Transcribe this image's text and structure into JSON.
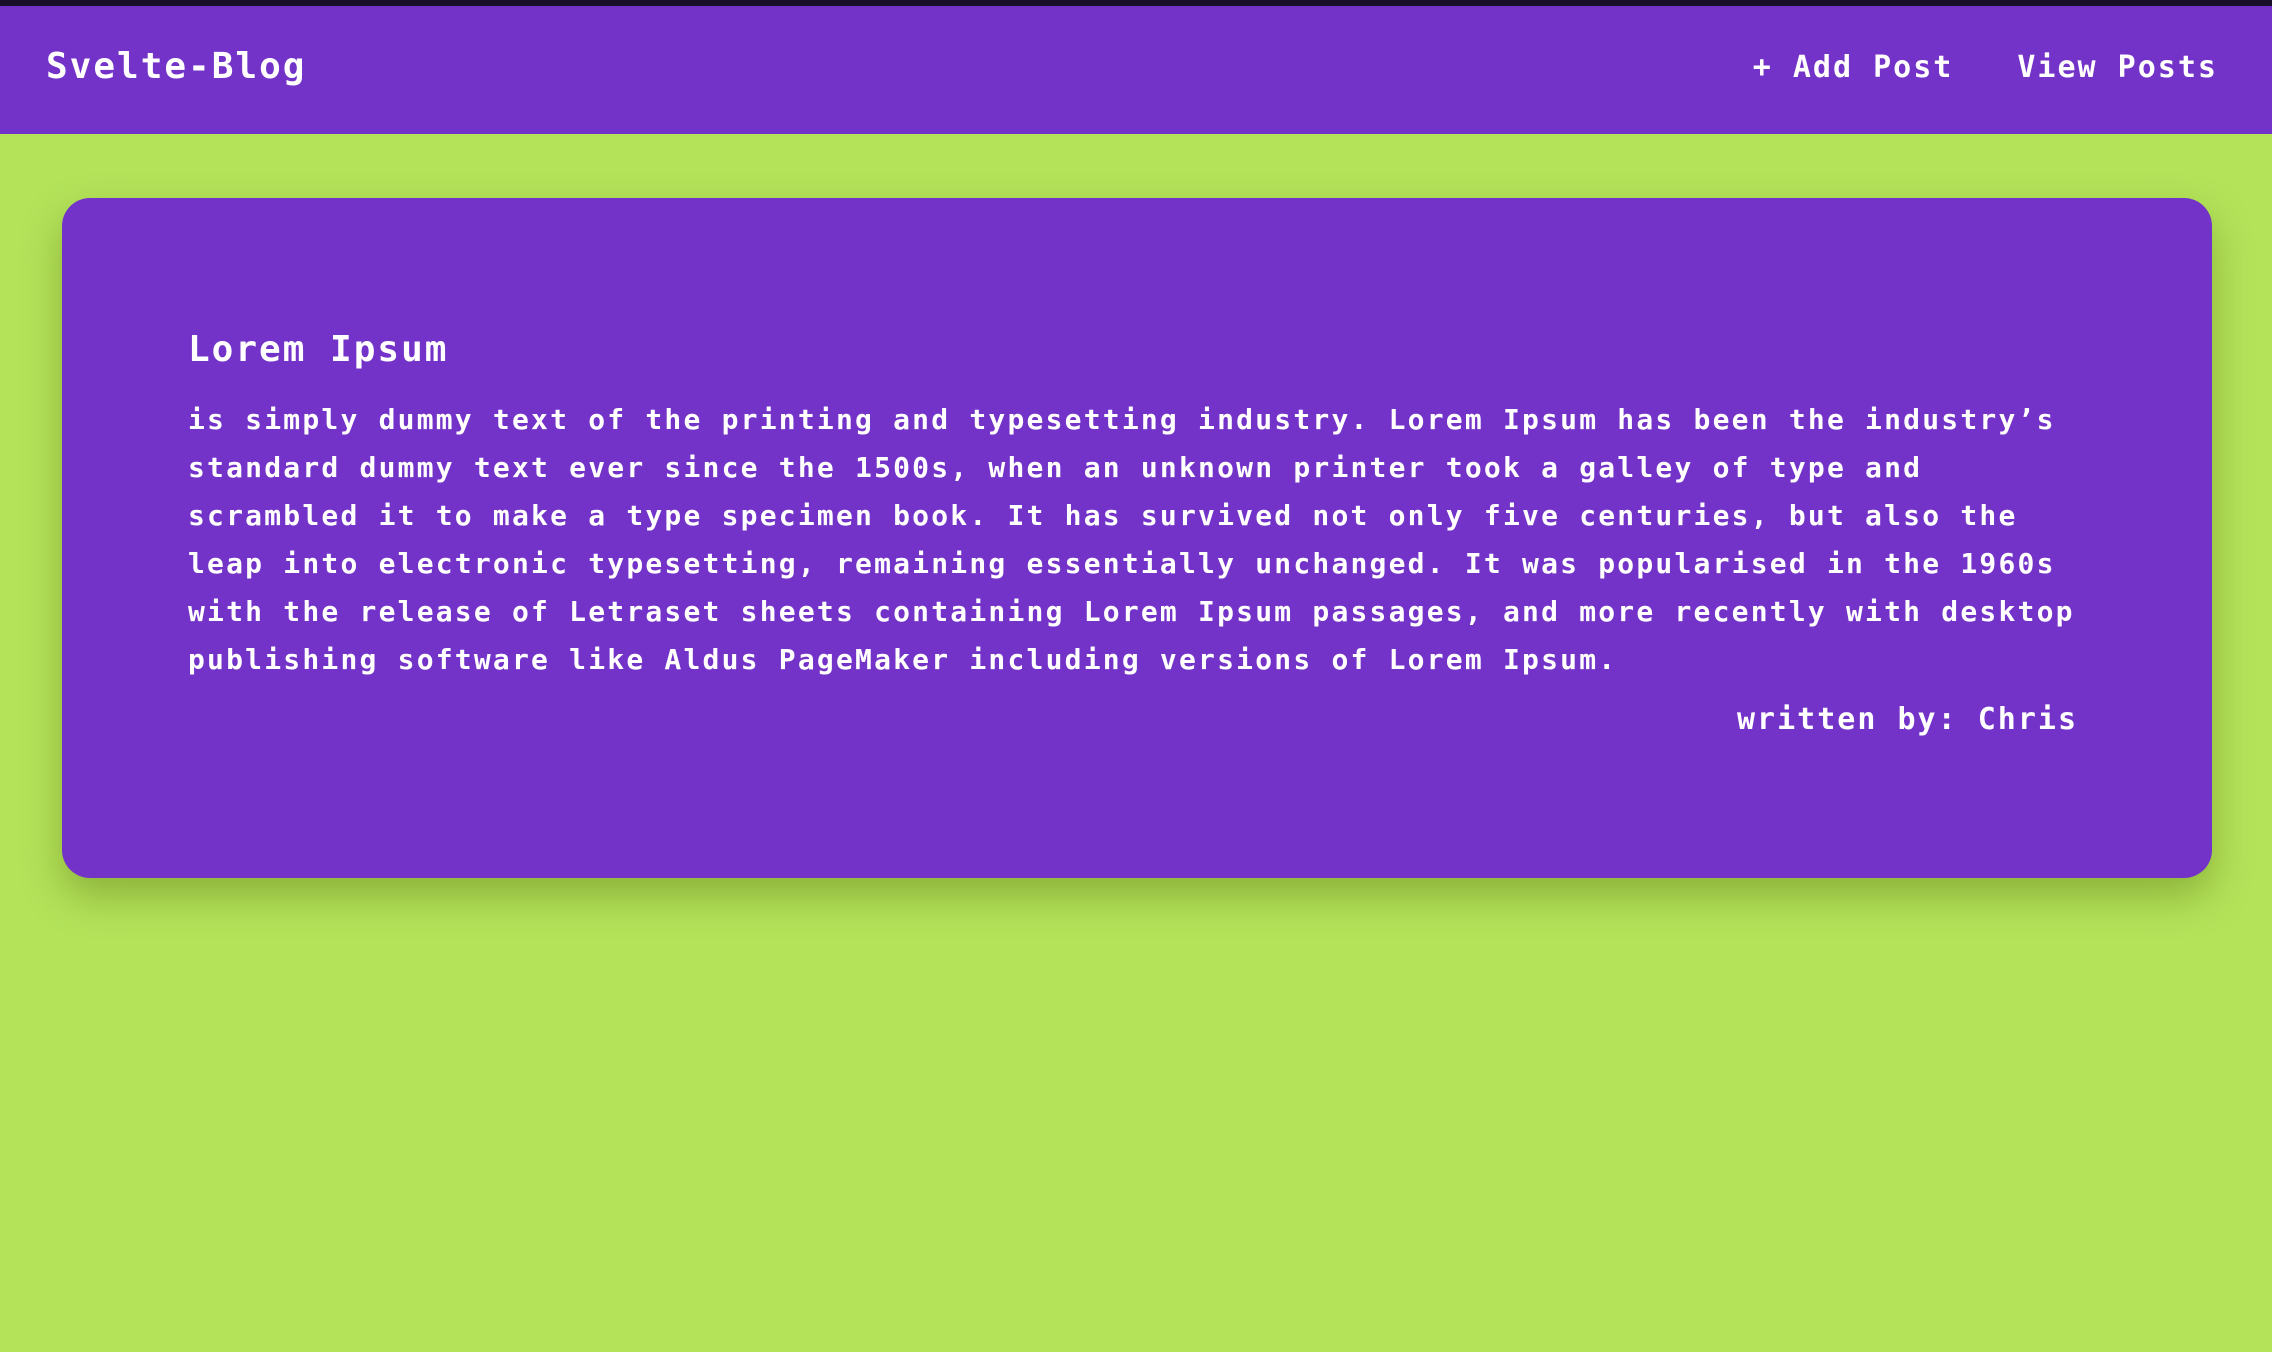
{
  "header": {
    "brand": "Svelte-Blog",
    "nav": [
      {
        "label": "+ Add Post"
      },
      {
        "label": "View Posts"
      }
    ]
  },
  "post": {
    "title": "Lorem Ipsum",
    "body": "is simply dummy text of the printing and typesetting industry. Lorem Ipsum has been the industry’s standard dummy text ever since the 1500s, when an unknown printer took a galley of type and scrambled it to make a type specimen book. It has survived not only five centuries, but also the leap into electronic typesetting, remaining essentially unchanged. It was popularised in the 1960s with the release of Letraset sheets containing Lorem Ipsum passages, and more recently with desktop publishing software like Aldus PageMaker including versions of Lorem Ipsum.",
    "author": "written by: Chris"
  },
  "colors": {
    "navbar": "#7332c8",
    "card": "#7332c8",
    "background": "#b4e35a",
    "text": "#ffffff"
  }
}
